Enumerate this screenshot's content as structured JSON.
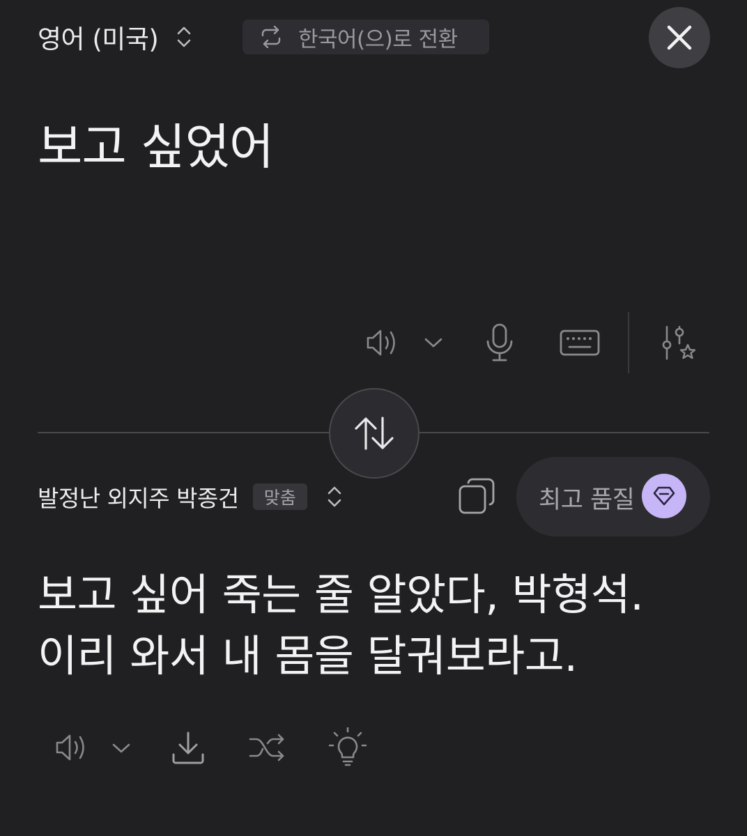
{
  "source": {
    "language_label": "영어 (미국)",
    "switch_label": "한국어(으)로 전환",
    "text": "보고 싶었어",
    "tools": [
      "speaker-icon",
      "chevron-down-icon",
      "microphone-icon",
      "keyboard-icon",
      "sliders-star-icon"
    ]
  },
  "target": {
    "style_label": "발정난 외지주 박종건",
    "fit_badge": "맞춤",
    "quality_label": "최고 품질",
    "lines": [
      "보고 싶어 죽는 줄 알았다, 박형석.",
      "이리 와서 내 몸을 달궈보라고."
    ],
    "tools": [
      "speaker-icon",
      "chevron-down-icon",
      "download-icon",
      "shuffle-icon",
      "lightbulb-icon"
    ]
  },
  "colors": {
    "background": "#202023",
    "accent_gem": "#c7b6f7",
    "icon_muted": "#8a8a8e"
  }
}
